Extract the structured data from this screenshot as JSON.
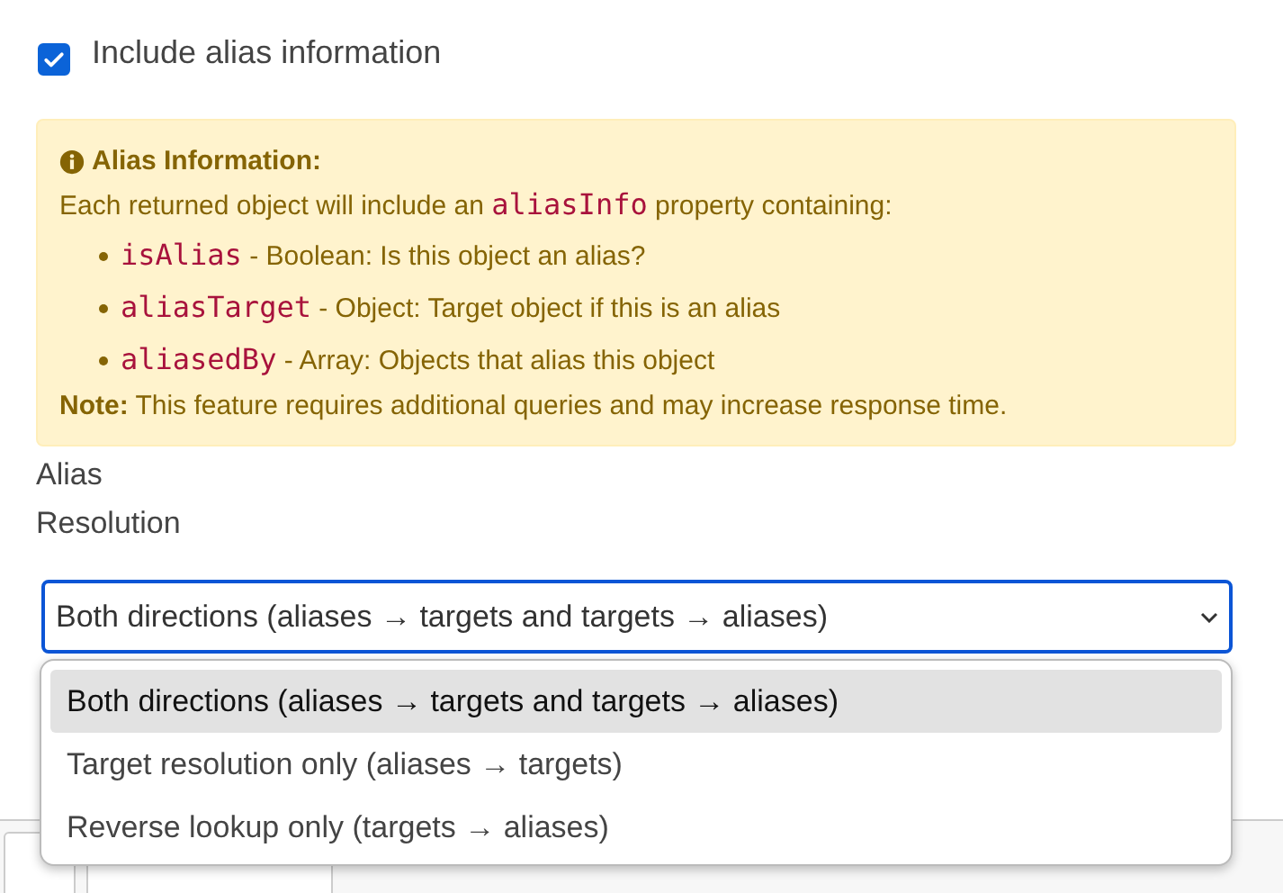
{
  "checkbox": {
    "label": "Include alias information",
    "checked": true
  },
  "alert": {
    "title": "Alias Information:",
    "intro": [
      {
        "kind": "text",
        "text": "Each returned object will include an "
      },
      {
        "kind": "code",
        "text": "aliasInfo"
      },
      {
        "kind": "text",
        "text": " property containing:"
      }
    ],
    "items": [
      {
        "code": "isAlias",
        "description": " - Boolean: Is this object an alias?"
      },
      {
        "code": "aliasTarget",
        "description": " - Object: Target object if this is an alias"
      },
      {
        "code": "aliasedBy",
        "description": " - Array: Objects that alias this object"
      }
    ],
    "note": "**Note:** This feature requires additional queries and may increase response time."
  },
  "select": {
    "label": "Alias Resolution",
    "value": "Both directions (aliases → targets and targets → aliases)",
    "options": [
      {
        "label": "Both directions (aliases → targets and targets → aliases)",
        "selected": true
      },
      {
        "label": "Target resolution only (aliases → targets)",
        "selected": false
      },
      {
        "label": "Reverse lookup only (targets → aliases)",
        "selected": false
      }
    ]
  }
}
